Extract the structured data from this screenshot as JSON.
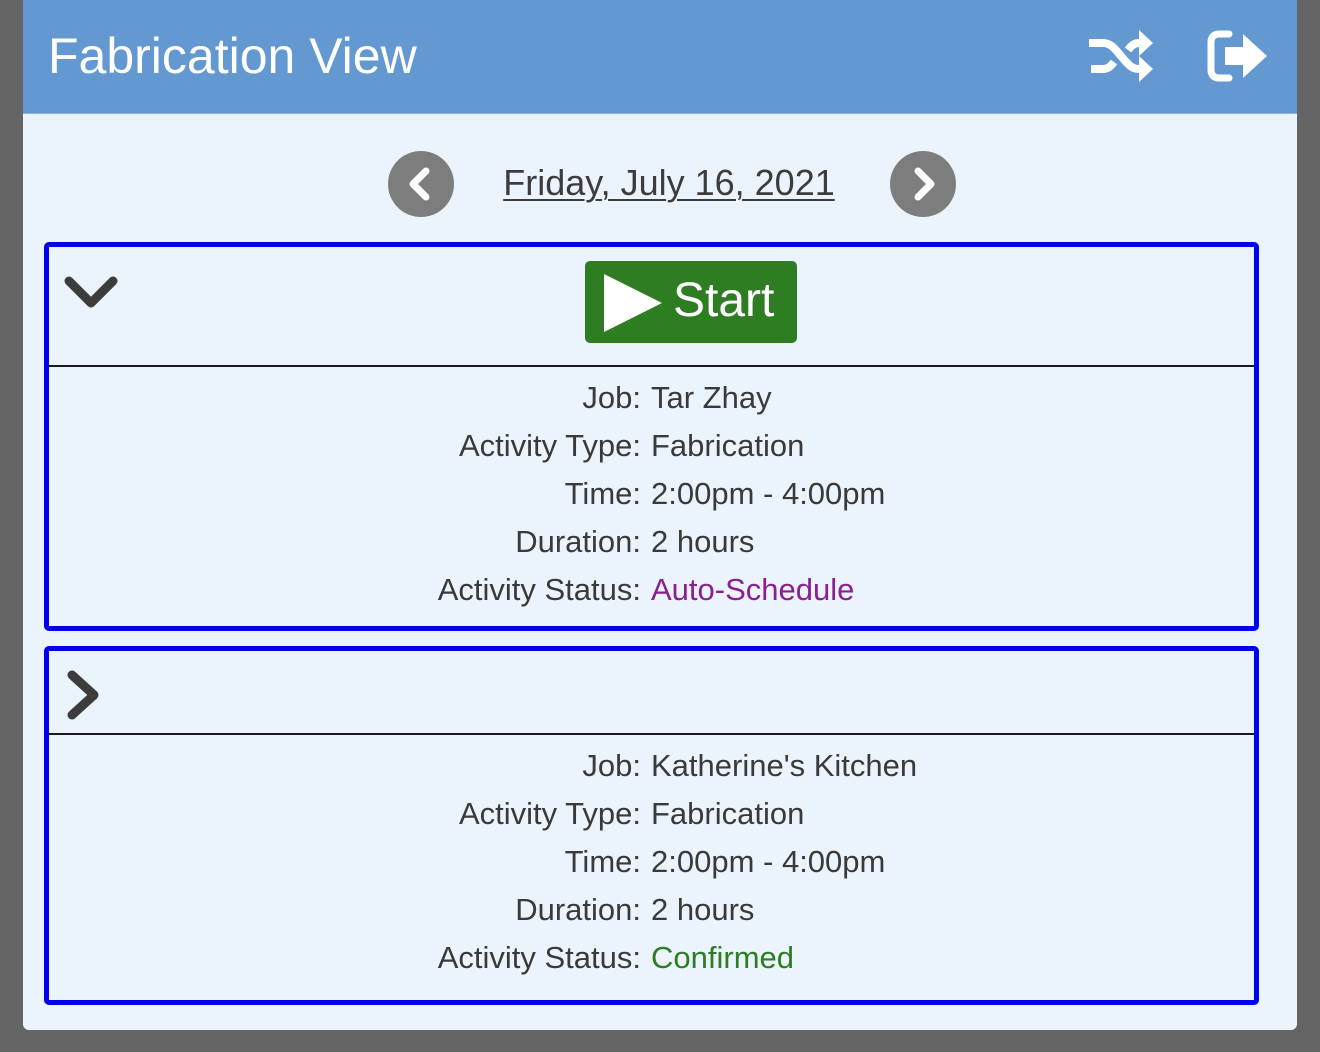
{
  "header": {
    "title": "Fabrication View",
    "icons": [
      "shuffle-icon",
      "logout-icon"
    ]
  },
  "datebar": {
    "date": "Friday, July 16, 2021",
    "prev_icon": "chevron-left-icon",
    "next_icon": "chevron-right-icon"
  },
  "activities": [
    {
      "expanded": true,
      "toggle_icon": "chevron-down-icon",
      "start_label": "Start",
      "labels": {
        "job": "Job:",
        "activity_type": "Activity Type:",
        "time": "Time:",
        "duration": "Duration:",
        "activity_status": "Activity Status:"
      },
      "job": "Tar Zhay",
      "activity_type": "Fabrication",
      "time": "2:00pm - 4:00pm",
      "duration": "2 hours",
      "activity_status": "Auto-Schedule",
      "status_color": "#8b1e91"
    },
    {
      "expanded": false,
      "toggle_icon": "chevron-right-icon",
      "labels": {
        "job": "Job:",
        "activity_type": "Activity Type:",
        "time": "Time:",
        "duration": "Duration:",
        "activity_status": "Activity Status:"
      },
      "job": "Katherine's Kitchen",
      "activity_type": "Fabrication",
      "time": "2:00pm - 4:00pm",
      "duration": "2 hours",
      "activity_status": "Confirmed",
      "status_color": "#2e7d22"
    }
  ],
  "colors": {
    "header_bg": "#6498d0",
    "page_bg": "#ebf3fc",
    "card_border": "#0000ee",
    "start_button": "#2e7d22",
    "nav_circle": "#7d7d7d"
  }
}
